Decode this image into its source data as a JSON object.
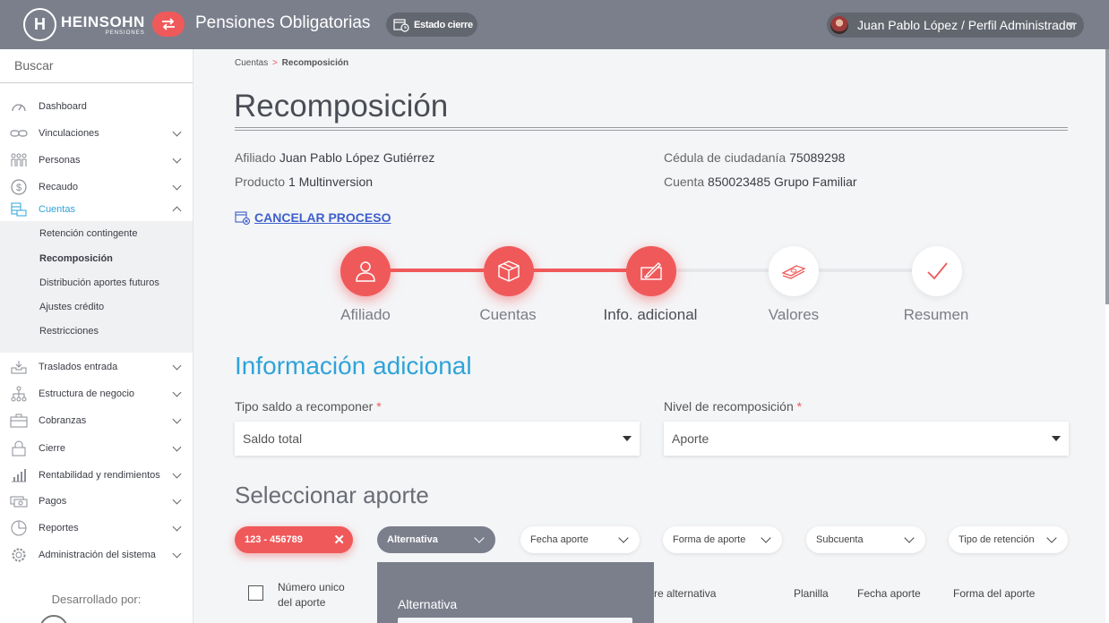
{
  "header": {
    "logo_name": "HEINSOHN",
    "logo_sub": "PENSIONES",
    "module_title": "Pensiones Obligatorias",
    "estado_label": "Estado cierre",
    "user_label": "Juan Pablo López / Perfil Administrador"
  },
  "sidebar": {
    "search_placeholder": "Buscar",
    "items": [
      {
        "label": "Dashboard",
        "icon": "gauge-icon"
      },
      {
        "label": "Vinculaciones",
        "icon": "link-icon"
      },
      {
        "label": "Personas",
        "icon": "people-icon"
      },
      {
        "label": "Recaudo",
        "icon": "dollar-icon"
      },
      {
        "label": "Cuentas",
        "icon": "coins-icon"
      },
      {
        "label": "Traslados entrada",
        "icon": "inbox-icon"
      },
      {
        "label": "Estructura de negocio",
        "icon": "hierarchy-icon"
      },
      {
        "label": "Cobranzas",
        "icon": "briefcase-icon"
      },
      {
        "label": "Cierre",
        "icon": "lock-icon"
      },
      {
        "label": "Rentabilidad y rendimientos",
        "icon": "bar-chart-icon"
      },
      {
        "label": "Pagos",
        "icon": "money-icon"
      },
      {
        "label": "Reportes",
        "icon": "pie-chart-icon"
      },
      {
        "label": "Administración del sistema",
        "icon": "gear-icon"
      }
    ],
    "subitems": [
      "Retención contingente",
      "Recomposición",
      "Distribución aportes futuros",
      "Ajustes crédito",
      "Restricciones"
    ],
    "developed_by": "Desarrollado por:"
  },
  "breadcrumb": {
    "parent": "Cuentas",
    "separator": ">",
    "current": "Recomposición"
  },
  "page_title": "Recomposición",
  "info": {
    "afiliado_label": "Afiliado",
    "afiliado_value": "Juan Pablo López Gutiérrez",
    "cedula_label": "Cédula de ciudadanía",
    "cedula_value": "75089298",
    "producto_label": "Producto",
    "producto_value": "1 Multinversion",
    "cuenta_label": "Cuenta",
    "cuenta_value": "850023485 Grupo Familiar"
  },
  "cancel_label": "CANCELAR PROCESO",
  "steps": [
    {
      "label": "Afiliado",
      "state": "done",
      "icon": "user-icon"
    },
    {
      "label": "Cuentas",
      "state": "done",
      "icon": "box-icon"
    },
    {
      "label": "Info. adicional",
      "state": "current",
      "icon": "edit-icon"
    },
    {
      "label": "Valores",
      "state": "todo",
      "icon": "cash-icon"
    },
    {
      "label": "Resumen",
      "state": "todo",
      "icon": "check-icon"
    }
  ],
  "section_title": "Información adicional",
  "fields": {
    "tipo_label": "Tipo saldo a recomponer",
    "tipo_value": "Saldo total",
    "nivel_label": "Nivel de recomposición",
    "nivel_value": "Aporte",
    "required_mark": "*"
  },
  "select_title": "Seleccionar aporte",
  "filters": {
    "active_chip": "123 - 456789",
    "open_filter": "Alternativa",
    "others": [
      "Fecha aporte",
      "Forma de aporte",
      "Subcuenta",
      "Tipo de retención"
    ]
  },
  "table_headers": {
    "numero_line1": "Número unico",
    "numero_line2": "del aporte",
    "alternativa": "re alternativa",
    "planilla": "Planilla",
    "fecha": "Fecha aporte",
    "forma": "Forma del aporte"
  },
  "dropdown": {
    "option": "Alternativa"
  },
  "colors": {
    "accent": "#f0595a",
    "primary": "#2fa3d8",
    "header": "#7b7f8c"
  }
}
